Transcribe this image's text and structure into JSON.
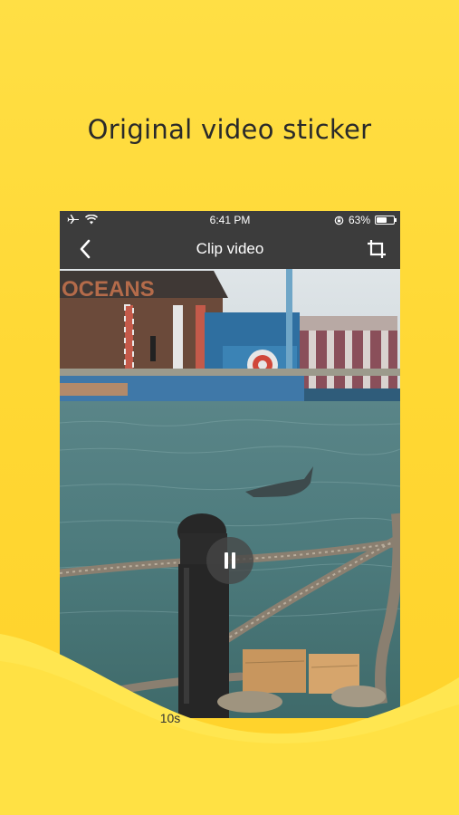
{
  "headline": "Original video sticker",
  "status_bar": {
    "time": "6:41 PM",
    "battery_percent": "63%",
    "battery_level": 0.63,
    "icons": [
      "airplane-icon",
      "wifi-icon",
      "rotation-lock-icon",
      "battery-icon"
    ]
  },
  "nav": {
    "title": "Clip video",
    "back_icon": "chevron-left-icon",
    "crop_icon": "crop-icon"
  },
  "video": {
    "sign_text": "OCEANS",
    "state": "playing",
    "duration_label": "10s"
  },
  "colors": {
    "background": "#ffd834",
    "wave": "#ffe95c",
    "bar": "#3c3c3c"
  }
}
